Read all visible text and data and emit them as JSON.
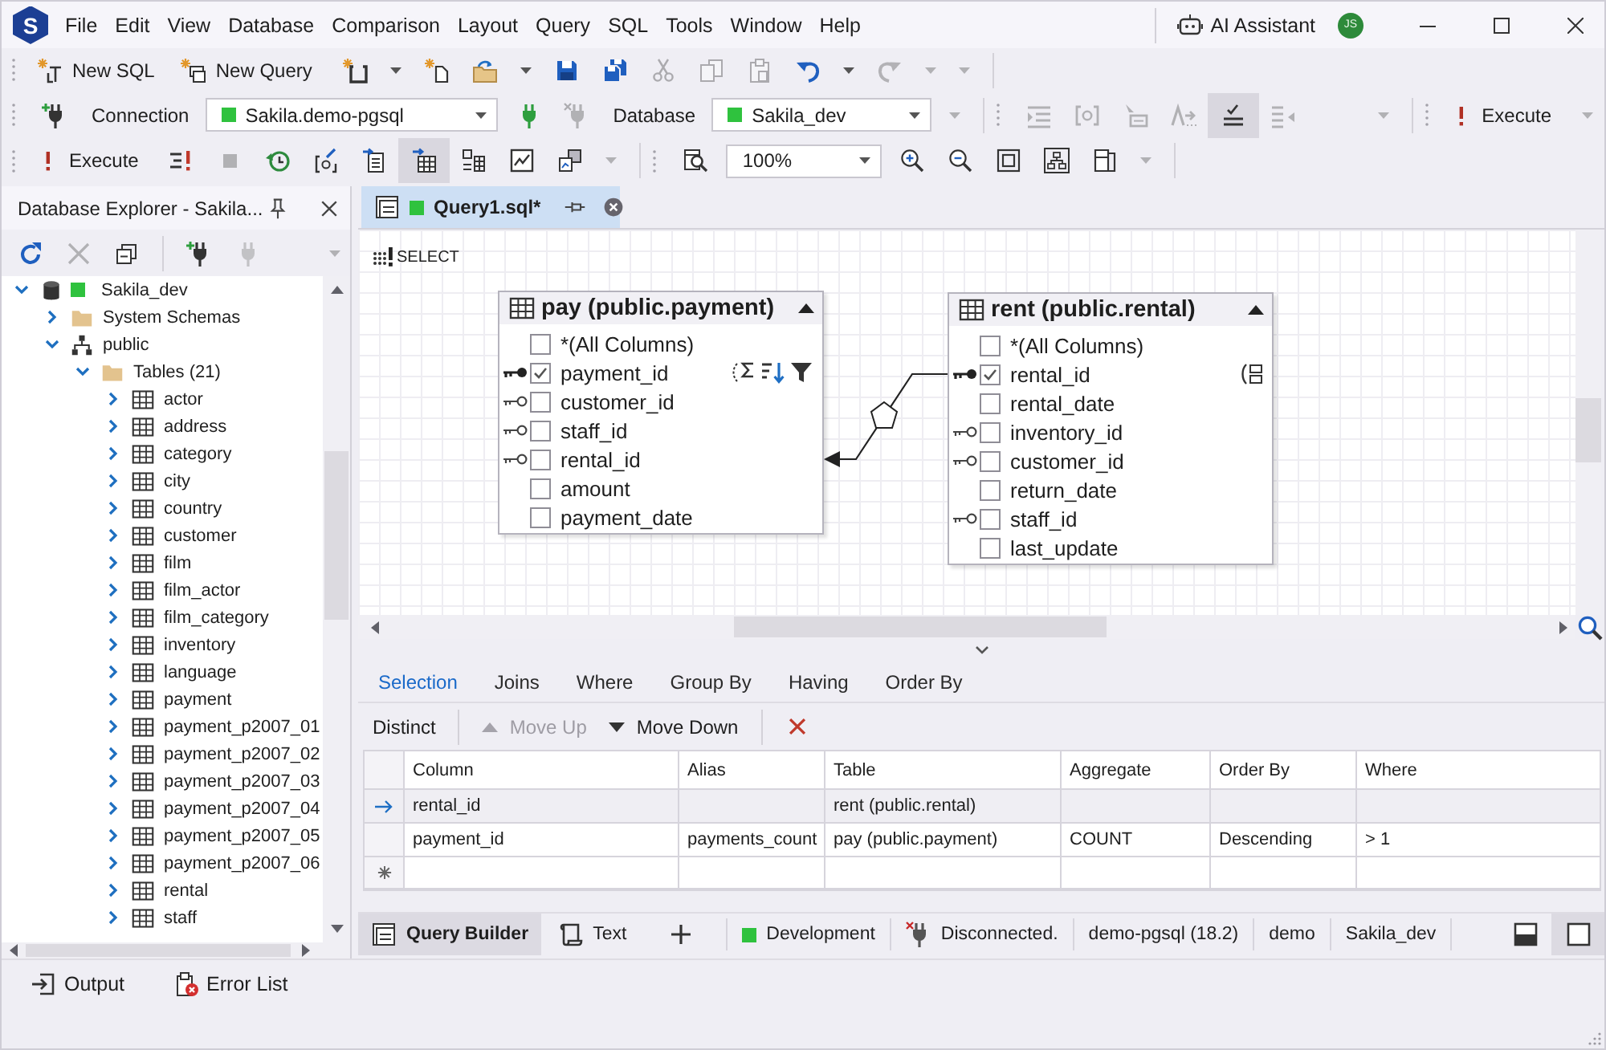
{
  "app": {
    "logo": "S"
  },
  "menu": [
    "File",
    "Edit",
    "View",
    "Database",
    "Comparison",
    "Layout",
    "Query",
    "SQL",
    "Tools",
    "Window",
    "Help"
  ],
  "title_bar": {
    "ai_assistant": "AI Assistant",
    "avatar": "JS"
  },
  "standard_toolbar": {
    "new_sql": "New SQL",
    "new_query": "New Query",
    "clipboard_disabled": true,
    "redo_disabled": true
  },
  "connection_toolbar": {
    "connection_label": "Connection",
    "connection": "Sakila.demo-pgsql",
    "disconnect_disabled": true,
    "database_label": "Database",
    "database": "Sakila_dev",
    "format_tools_disabled": true,
    "sql_check_selected": true,
    "execute": "Execute"
  },
  "query_toolbar": {
    "execute": "Execute",
    "stop_disabled": true,
    "grid_view_selected": true,
    "zoom": "100%"
  },
  "database_explorer": {
    "title": "Database Explorer - Sakila...",
    "delete_disabled": true,
    "disconnect_disabled": true,
    "tree": [
      {
        "label": "Sakila_dev",
        "kind": "database",
        "expanded": true,
        "children": [
          {
            "label": "System Schemas",
            "kind": "folder",
            "expanded": false
          },
          {
            "label": "public",
            "kind": "schema",
            "expanded": true,
            "children": [
              {
                "label": "Tables (21)",
                "kind": "folder",
                "expanded": true,
                "children": [
                  {
                    "label": "actor",
                    "kind": "table",
                    "expanded": false
                  },
                  {
                    "label": "address",
                    "kind": "table",
                    "expanded": false
                  },
                  {
                    "label": "category",
                    "kind": "table",
                    "expanded": false
                  },
                  {
                    "label": "city",
                    "kind": "table",
                    "expanded": false
                  },
                  {
                    "label": "country",
                    "kind": "table",
                    "expanded": false
                  },
                  {
                    "label": "customer",
                    "kind": "table",
                    "expanded": false
                  },
                  {
                    "label": "film",
                    "kind": "table",
                    "expanded": false
                  },
                  {
                    "label": "film_actor",
                    "kind": "table",
                    "expanded": false
                  },
                  {
                    "label": "film_category",
                    "kind": "table",
                    "expanded": false
                  },
                  {
                    "label": "inventory",
                    "kind": "table",
                    "expanded": false
                  },
                  {
                    "label": "language",
                    "kind": "table",
                    "expanded": false
                  },
                  {
                    "label": "payment",
                    "kind": "table",
                    "expanded": false
                  },
                  {
                    "label": "payment_p2007_01",
                    "kind": "table",
                    "expanded": false
                  },
                  {
                    "label": "payment_p2007_02",
                    "kind": "table",
                    "expanded": false
                  },
                  {
                    "label": "payment_p2007_03",
                    "kind": "table",
                    "expanded": false
                  },
                  {
                    "label": "payment_p2007_04",
                    "kind": "table",
                    "expanded": false
                  },
                  {
                    "label": "payment_p2007_05",
                    "kind": "table",
                    "expanded": false
                  },
                  {
                    "label": "payment_p2007_06",
                    "kind": "table",
                    "expanded": false
                  },
                  {
                    "label": "rental",
                    "kind": "table",
                    "expanded": false
                  },
                  {
                    "label": "staff",
                    "kind": "table",
                    "expanded": false
                  }
                ]
              }
            ]
          }
        ]
      }
    ]
  },
  "document_tab": {
    "title": "Query1.sql*",
    "selected": true
  },
  "diagram": {
    "statement": "SELECT",
    "tables": [
      {
        "title": "pay (public.payment)",
        "columns": [
          {
            "name": "*(All Columns)",
            "kind": "column",
            "checked": false
          },
          {
            "name": "payment_id",
            "kind": "primary-key",
            "checked": true,
            "markers": [
              {
                "kind": "aggregate"
              },
              {
                "kind": "sort-descending"
              },
              {
                "kind": "filter"
              }
            ]
          },
          {
            "name": "customer_id",
            "kind": "foreign-key",
            "checked": false
          },
          {
            "name": "staff_id",
            "kind": "foreign-key",
            "checked": false
          },
          {
            "name": "rental_id",
            "kind": "foreign-key",
            "checked": false,
            "joined": true
          },
          {
            "name": "amount",
            "kind": "column",
            "checked": false
          },
          {
            "name": "payment_date",
            "kind": "column",
            "checked": false
          }
        ]
      },
      {
        "title": "rent (public.rental)",
        "columns": [
          {
            "name": "*(All Columns)",
            "kind": "column",
            "checked": false
          },
          {
            "name": "rental_id",
            "kind": "primary-key",
            "checked": true,
            "joined": true,
            "markers": [
              {
                "kind": "group-by"
              }
            ]
          },
          {
            "name": "rental_date",
            "kind": "column",
            "checked": false
          },
          {
            "name": "inventory_id",
            "kind": "foreign-key",
            "checked": false
          },
          {
            "name": "customer_id",
            "kind": "foreign-key",
            "checked": false
          },
          {
            "name": "return_date",
            "kind": "column",
            "checked": false
          },
          {
            "name": "staff_id",
            "kind": "foreign-key",
            "checked": false
          },
          {
            "name": "last_update",
            "kind": "column",
            "checked": false
          }
        ]
      }
    ]
  },
  "builder_tabs": [
    {
      "label": "Selection",
      "selected": true
    },
    {
      "label": "Joins",
      "selected": false
    },
    {
      "label": "Where",
      "selected": false
    },
    {
      "label": "Group By",
      "selected": false
    },
    {
      "label": "Having",
      "selected": false
    },
    {
      "label": "Order By",
      "selected": false
    }
  ],
  "selection_toolbar": {
    "distinct": "Distinct",
    "move_up": {
      "label": "Move Up",
      "disabled": true
    },
    "move_down": {
      "label": "Move Down",
      "disabled": false
    }
  },
  "selection_grid": {
    "columns": [
      "Column",
      "Alias",
      "Table",
      "Aggregate",
      "Order By",
      "Where"
    ],
    "rows": [
      {
        "selected": true,
        "column": "rental_id",
        "table": "rent (public.rental)"
      },
      {
        "selected": false,
        "column": "payment_id",
        "alias": "payments_count",
        "table": "pay (public.payment)",
        "aggregate": "COUNT",
        "order_by": "Descending",
        "where": "> 1"
      }
    ]
  },
  "view_tabs": [
    {
      "label": "Query Builder",
      "kind": "builder",
      "selected": true
    },
    {
      "label": "Text",
      "kind": "text",
      "selected": false
    }
  ],
  "status_bar": {
    "environment": "Development",
    "connection_state": "Disconnected.",
    "server": "demo-pgsql (18.2)",
    "user": "demo",
    "database": "Sakila_dev",
    "panes": [
      {
        "kind": "bottom",
        "selected": false
      },
      {
        "kind": "single",
        "selected": true
      }
    ]
  },
  "tool_windows": [
    {
      "label": "Output",
      "kind": "output"
    },
    {
      "label": "Error List",
      "kind": "errors"
    }
  ]
}
